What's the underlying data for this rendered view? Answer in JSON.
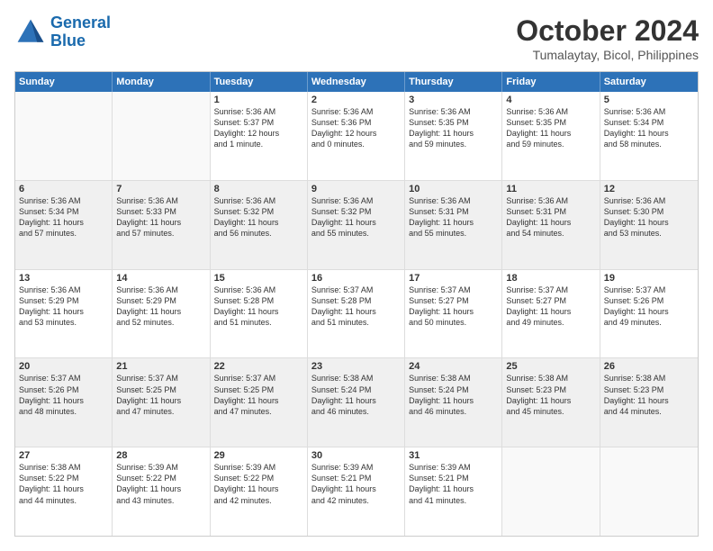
{
  "logo": {
    "line1": "General",
    "line2": "Blue"
  },
  "title": "October 2024",
  "subtitle": "Tumalaytay, Bicol, Philippines",
  "header_days": [
    "Sunday",
    "Monday",
    "Tuesday",
    "Wednesday",
    "Thursday",
    "Friday",
    "Saturday"
  ],
  "rows": [
    [
      {
        "day": "",
        "text": "",
        "empty": true
      },
      {
        "day": "",
        "text": "",
        "empty": true
      },
      {
        "day": "1",
        "text": "Sunrise: 5:36 AM\nSunset: 5:37 PM\nDaylight: 12 hours\nand 1 minute.",
        "empty": false
      },
      {
        "day": "2",
        "text": "Sunrise: 5:36 AM\nSunset: 5:36 PM\nDaylight: 12 hours\nand 0 minutes.",
        "empty": false
      },
      {
        "day": "3",
        "text": "Sunrise: 5:36 AM\nSunset: 5:35 PM\nDaylight: 11 hours\nand 59 minutes.",
        "empty": false
      },
      {
        "day": "4",
        "text": "Sunrise: 5:36 AM\nSunset: 5:35 PM\nDaylight: 11 hours\nand 59 minutes.",
        "empty": false
      },
      {
        "day": "5",
        "text": "Sunrise: 5:36 AM\nSunset: 5:34 PM\nDaylight: 11 hours\nand 58 minutes.",
        "empty": false
      }
    ],
    [
      {
        "day": "6",
        "text": "Sunrise: 5:36 AM\nSunset: 5:34 PM\nDaylight: 11 hours\nand 57 minutes.",
        "empty": false
      },
      {
        "day": "7",
        "text": "Sunrise: 5:36 AM\nSunset: 5:33 PM\nDaylight: 11 hours\nand 57 minutes.",
        "empty": false
      },
      {
        "day": "8",
        "text": "Sunrise: 5:36 AM\nSunset: 5:32 PM\nDaylight: 11 hours\nand 56 minutes.",
        "empty": false
      },
      {
        "day": "9",
        "text": "Sunrise: 5:36 AM\nSunset: 5:32 PM\nDaylight: 11 hours\nand 55 minutes.",
        "empty": false
      },
      {
        "day": "10",
        "text": "Sunrise: 5:36 AM\nSunset: 5:31 PM\nDaylight: 11 hours\nand 55 minutes.",
        "empty": false
      },
      {
        "day": "11",
        "text": "Sunrise: 5:36 AM\nSunset: 5:31 PM\nDaylight: 11 hours\nand 54 minutes.",
        "empty": false
      },
      {
        "day": "12",
        "text": "Sunrise: 5:36 AM\nSunset: 5:30 PM\nDaylight: 11 hours\nand 53 minutes.",
        "empty": false
      }
    ],
    [
      {
        "day": "13",
        "text": "Sunrise: 5:36 AM\nSunset: 5:29 PM\nDaylight: 11 hours\nand 53 minutes.",
        "empty": false
      },
      {
        "day": "14",
        "text": "Sunrise: 5:36 AM\nSunset: 5:29 PM\nDaylight: 11 hours\nand 52 minutes.",
        "empty": false
      },
      {
        "day": "15",
        "text": "Sunrise: 5:36 AM\nSunset: 5:28 PM\nDaylight: 11 hours\nand 51 minutes.",
        "empty": false
      },
      {
        "day": "16",
        "text": "Sunrise: 5:37 AM\nSunset: 5:28 PM\nDaylight: 11 hours\nand 51 minutes.",
        "empty": false
      },
      {
        "day": "17",
        "text": "Sunrise: 5:37 AM\nSunset: 5:27 PM\nDaylight: 11 hours\nand 50 minutes.",
        "empty": false
      },
      {
        "day": "18",
        "text": "Sunrise: 5:37 AM\nSunset: 5:27 PM\nDaylight: 11 hours\nand 49 minutes.",
        "empty": false
      },
      {
        "day": "19",
        "text": "Sunrise: 5:37 AM\nSunset: 5:26 PM\nDaylight: 11 hours\nand 49 minutes.",
        "empty": false
      }
    ],
    [
      {
        "day": "20",
        "text": "Sunrise: 5:37 AM\nSunset: 5:26 PM\nDaylight: 11 hours\nand 48 minutes.",
        "empty": false
      },
      {
        "day": "21",
        "text": "Sunrise: 5:37 AM\nSunset: 5:25 PM\nDaylight: 11 hours\nand 47 minutes.",
        "empty": false
      },
      {
        "day": "22",
        "text": "Sunrise: 5:37 AM\nSunset: 5:25 PM\nDaylight: 11 hours\nand 47 minutes.",
        "empty": false
      },
      {
        "day": "23",
        "text": "Sunrise: 5:38 AM\nSunset: 5:24 PM\nDaylight: 11 hours\nand 46 minutes.",
        "empty": false
      },
      {
        "day": "24",
        "text": "Sunrise: 5:38 AM\nSunset: 5:24 PM\nDaylight: 11 hours\nand 46 minutes.",
        "empty": false
      },
      {
        "day": "25",
        "text": "Sunrise: 5:38 AM\nSunset: 5:23 PM\nDaylight: 11 hours\nand 45 minutes.",
        "empty": false
      },
      {
        "day": "26",
        "text": "Sunrise: 5:38 AM\nSunset: 5:23 PM\nDaylight: 11 hours\nand 44 minutes.",
        "empty": false
      }
    ],
    [
      {
        "day": "27",
        "text": "Sunrise: 5:38 AM\nSunset: 5:22 PM\nDaylight: 11 hours\nand 44 minutes.",
        "empty": false
      },
      {
        "day": "28",
        "text": "Sunrise: 5:39 AM\nSunset: 5:22 PM\nDaylight: 11 hours\nand 43 minutes.",
        "empty": false
      },
      {
        "day": "29",
        "text": "Sunrise: 5:39 AM\nSunset: 5:22 PM\nDaylight: 11 hours\nand 42 minutes.",
        "empty": false
      },
      {
        "day": "30",
        "text": "Sunrise: 5:39 AM\nSunset: 5:21 PM\nDaylight: 11 hours\nand 42 minutes.",
        "empty": false
      },
      {
        "day": "31",
        "text": "Sunrise: 5:39 AM\nSunset: 5:21 PM\nDaylight: 11 hours\nand 41 minutes.",
        "empty": false
      },
      {
        "day": "",
        "text": "",
        "empty": true
      },
      {
        "day": "",
        "text": "",
        "empty": true
      }
    ]
  ]
}
